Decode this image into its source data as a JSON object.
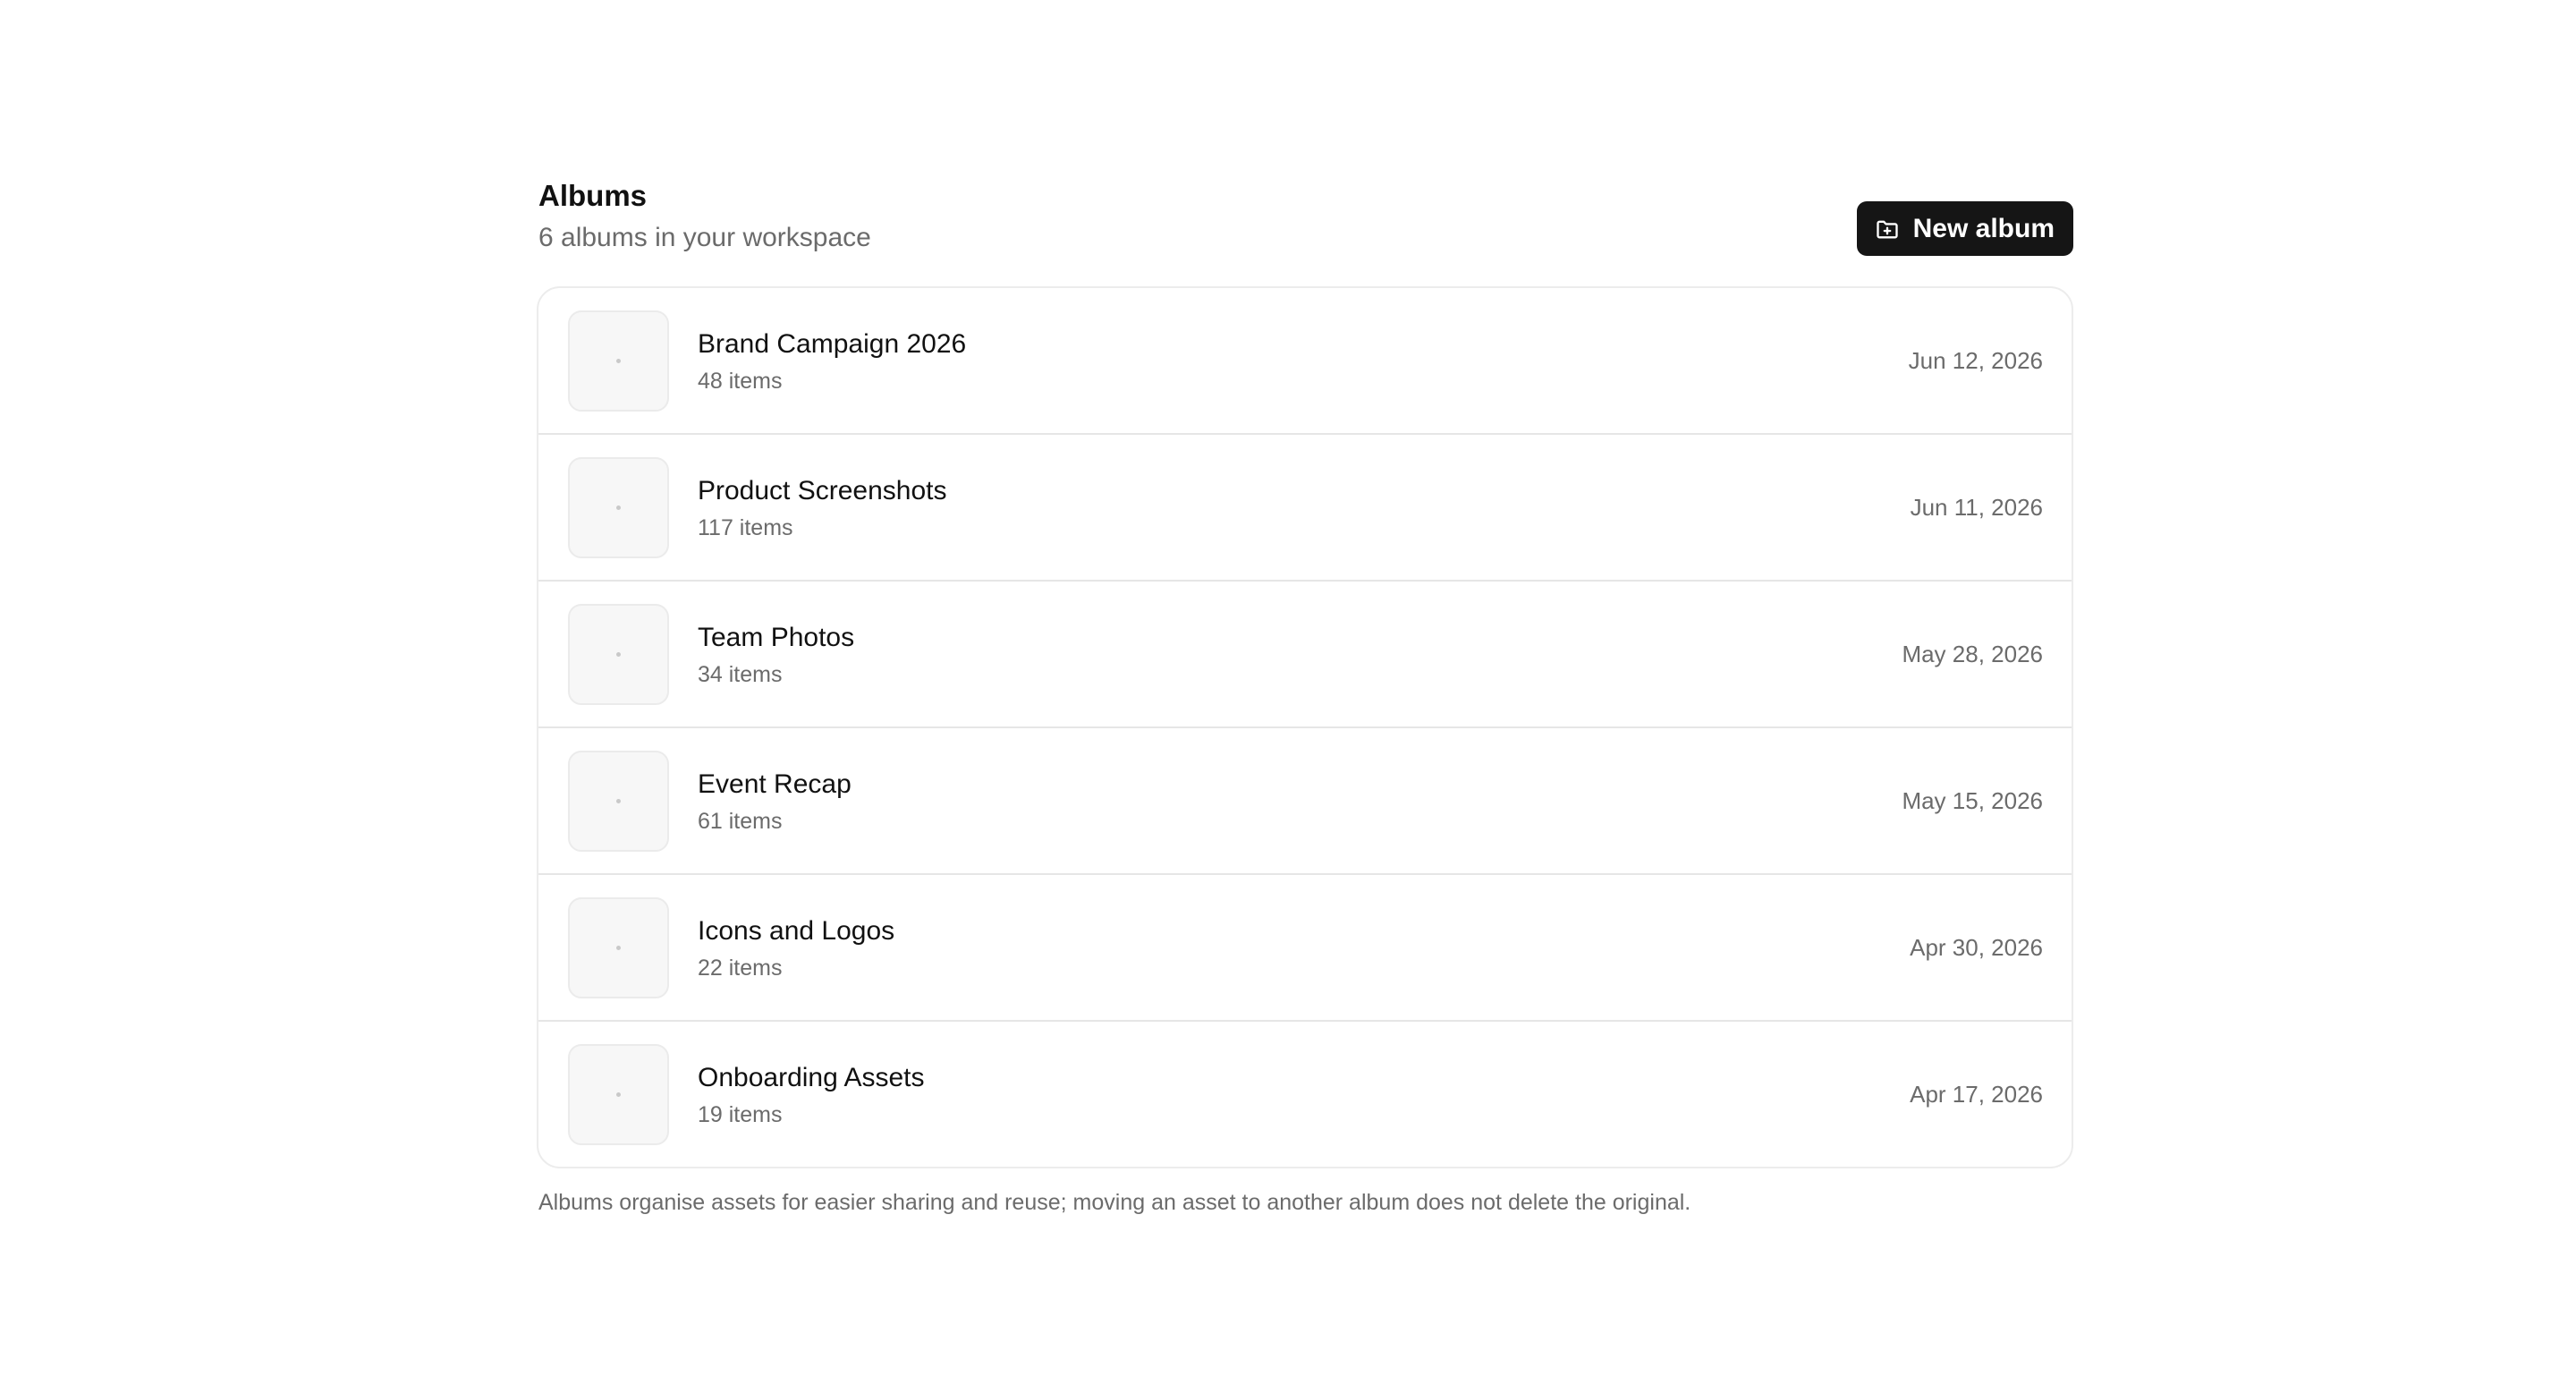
{
  "header": {
    "title": "Albums",
    "subtitle": "6 albums in your workspace",
    "new_album_label": "New album",
    "new_album_icon": "folder-plus-icon",
    "button_bg": "#151515"
  },
  "albums": [
    {
      "name": "Brand Campaign 2026",
      "count": "48 items",
      "date": "Jun 12, 2026"
    },
    {
      "name": "Product Screenshots",
      "count": "117 items",
      "date": "Jun 11, 2026"
    },
    {
      "name": "Team Photos",
      "count": "34 items",
      "date": "May 28, 2026"
    },
    {
      "name": "Event Recap",
      "count": "61 items",
      "date": "May 15, 2026"
    },
    {
      "name": "Icons and Logos",
      "count": "22 items",
      "date": "Apr 30, 2026"
    },
    {
      "name": "Onboarding Assets",
      "count": "19 items",
      "date": "Apr 17, 2026"
    }
  ],
  "footnote": "Albums organise assets for easier sharing and reuse; moving an asset to another album does not delete the original."
}
